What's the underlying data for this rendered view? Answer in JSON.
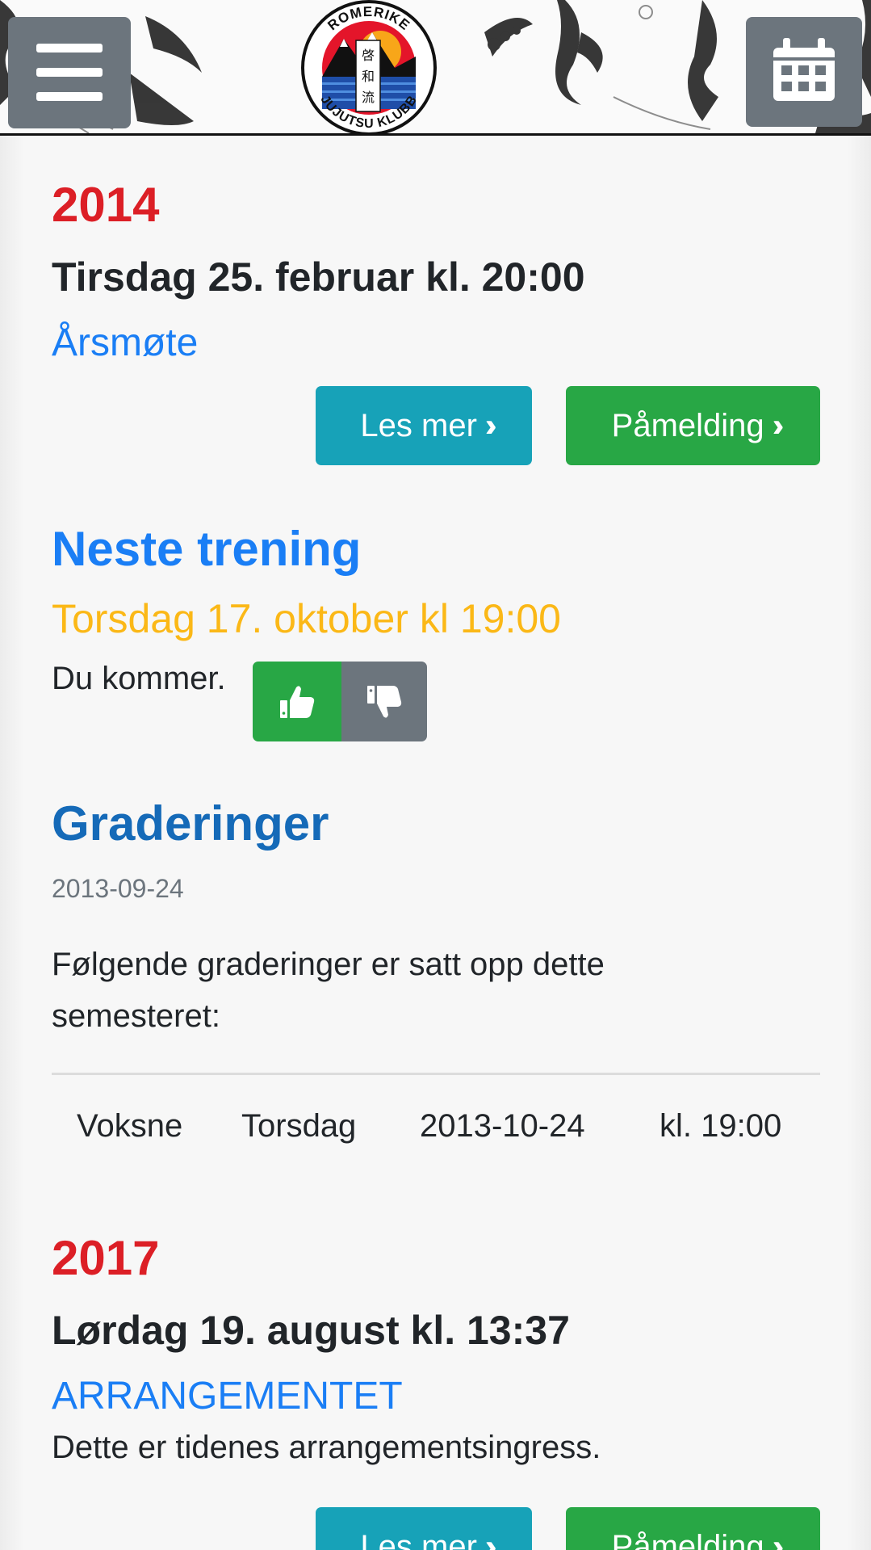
{
  "header": {
    "menu_icon": "hamburger-icon",
    "calendar_icon": "calendar-icon",
    "logo": {
      "top_text": "ROMERIKE",
      "bottom_text": "JUJUTSU KLUBB",
      "kanji": [
        "啓",
        "和",
        "流"
      ]
    }
  },
  "event1": {
    "year": "2014",
    "date": "Tirsdag 25. februar kl. 20:00",
    "title": "Årsmøte",
    "read_more": "Les mer",
    "signup": "Påmelding"
  },
  "next_training": {
    "title": "Neste trening",
    "date": "Torsdag 17. oktober kl 19:00",
    "status": "Du kommer.",
    "thumbs_up_icon": "thumbs-up-icon",
    "thumbs_down_icon": "thumbs-down-icon"
  },
  "gradings": {
    "title": "Graderinger",
    "date": "2013-09-24",
    "intro_line1": "Følgende graderinger er satt opp dette",
    "intro_line2": "semesteret:",
    "rows": [
      {
        "group": "Voksne",
        "day": "Torsdag",
        "date": "2013-10-24",
        "time": "kl. 19:00"
      }
    ]
  },
  "event2": {
    "year": "2017",
    "date": "Lørdag 19. august kl. 13:37",
    "title": "ARRANGEMENTET",
    "ingress": "Dette er tidenes arrangementsingress.",
    "read_more": "Les mer",
    "signup": "Påmelding"
  },
  "colors": {
    "year_red": "#dc1f26",
    "link_blue": "#1a7ef5",
    "training_yellow": "#fbb817",
    "btn_info": "#17a2b8",
    "btn_success": "#28a745",
    "btn_secondary": "#6c757d"
  }
}
